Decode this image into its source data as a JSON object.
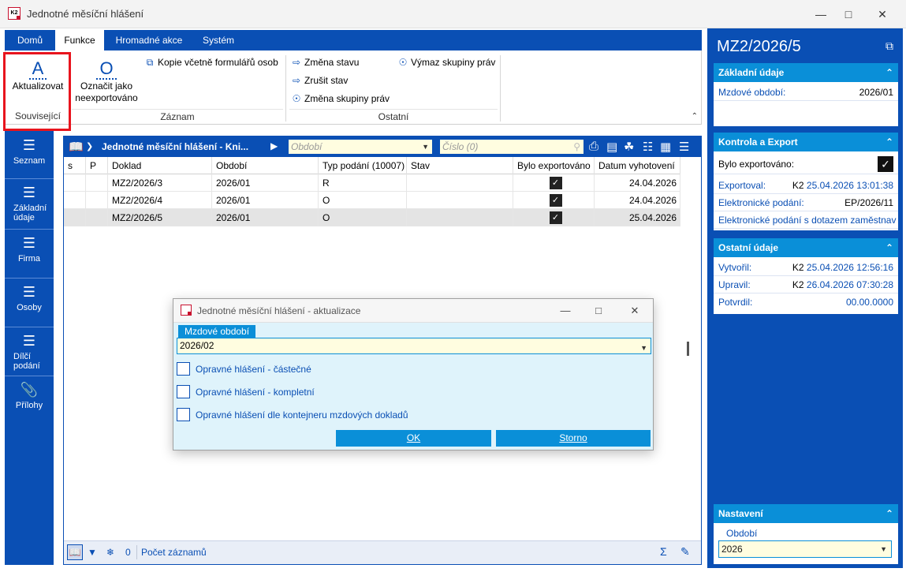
{
  "window": {
    "title": "Jednotné měsíční hlášení",
    "logo": "K2"
  },
  "ribbon": {
    "tabs": [
      "Domů",
      "Funkce",
      "Hromadné akce",
      "Systém"
    ],
    "active_tab": "Funkce",
    "actions": {
      "aktualizovat": "Aktualizovat",
      "oznacit_line1": "Označit jako",
      "oznacit_line2": "neexportováno",
      "kopie": "Kopie včetně formulářů osob",
      "zmena_stavu": "Změna stavu",
      "zrusit_stav": "Zrušit stav",
      "zmena_skupiny": "Změna skupiny práv",
      "vymaz_skupiny": "Výmaz skupiny práv"
    },
    "groups": {
      "souvisejici": "Související",
      "zaznam": "Záznam",
      "ostatni": "Ostatní"
    }
  },
  "leftnav": {
    "items": [
      {
        "label": "Seznam",
        "icon": "list-icon"
      },
      {
        "label": "Základní údaje",
        "icon": "list-icon"
      },
      {
        "label": "Firma",
        "icon": "list-icon"
      },
      {
        "label": "Osoby",
        "icon": "list-icon"
      },
      {
        "label": "Dílčí podání",
        "icon": "list-icon"
      },
      {
        "label": "Přílohy",
        "icon": "paperclip-icon"
      }
    ]
  },
  "grid": {
    "title": "Jednotné měsíční hlášení - Kni...",
    "filter_obdobi_placeholder": "Období",
    "filter_cislo_placeholder": "Číslo (0)",
    "columns": [
      "s",
      "P",
      "Doklad",
      "Období",
      "Typ podání (10007)",
      "Stav",
      "Bylo exportováno",
      "Datum vyhotovení"
    ],
    "rows": [
      {
        "s": "",
        "p": "",
        "doklad": "MZ2/2026/3",
        "obdobi": "2026/01",
        "typ": "R",
        "stav": "",
        "exportovano": true,
        "datum": "24.04.2026"
      },
      {
        "s": "",
        "p": "",
        "doklad": "MZ2/2026/4",
        "obdobi": "2026/01",
        "typ": "O",
        "stav": "",
        "exportovano": true,
        "datum": "24.04.2026"
      },
      {
        "s": "",
        "p": "",
        "doklad": "MZ2/2026/5",
        "obdobi": "2026/01",
        "typ": "O",
        "stav": "",
        "exportovano": true,
        "datum": "25.04.2026"
      }
    ],
    "selected_row": 2,
    "footer": {
      "count": "0",
      "pocet_zaznamu": "Počet záznamů"
    }
  },
  "dialog": {
    "title": "Jednotné měsíční hlášení - aktualizace",
    "field_label": "Mzdové období",
    "field_value": "2026/02",
    "checkboxes": [
      "Opravné hlášení - částečné",
      "Opravné hlášení - kompletní",
      "Opravné hlášení dle kontejneru mzdových dokladů"
    ],
    "ok_label": "OK",
    "storno_label": "Storno"
  },
  "right_panel": {
    "title": "MZ2/2026/5",
    "zakladni": {
      "header": "Základní údaje",
      "mzdove_obdobi_label": "Mzdové období:",
      "mzdove_obdobi_value": "2026/01"
    },
    "kontrola": {
      "header": "Kontrola a Export",
      "bylo_exportovano_label": "Bylo exportováno:",
      "exportoval_label": "Exportoval:",
      "exportoval_user": "K2",
      "exportoval_ts": "25.04.2026 13:01:38",
      "el_podani_label": "Elektronické podání:",
      "el_podani_value": "EP/2026/11",
      "el_podani_dotaz_label": "Elektronické podání s dotazem zaměstnav"
    },
    "ostatni": {
      "header": "Ostatní údaje",
      "vytvoril_label": "Vytvořil:",
      "vytvoril_user": "K2",
      "vytvoril_ts": "25.04.2026 12:56:16",
      "upravil_label": "Upravil:",
      "upravil_user": "K2",
      "upravil_ts": "26.04.2026 07:30:28",
      "potvrdil_label": "Potvrdil:",
      "potvrdil_value": "00.00.0000"
    },
    "nastaveni": {
      "header": "Nastavení",
      "obdobi_label": "Období",
      "obdobi_value": "2026"
    }
  },
  "colors": {
    "accent": "#0a4fb4",
    "accent_light": "#0a8fd8",
    "highlight": "#e8141d",
    "field_bg": "#fffde0"
  }
}
